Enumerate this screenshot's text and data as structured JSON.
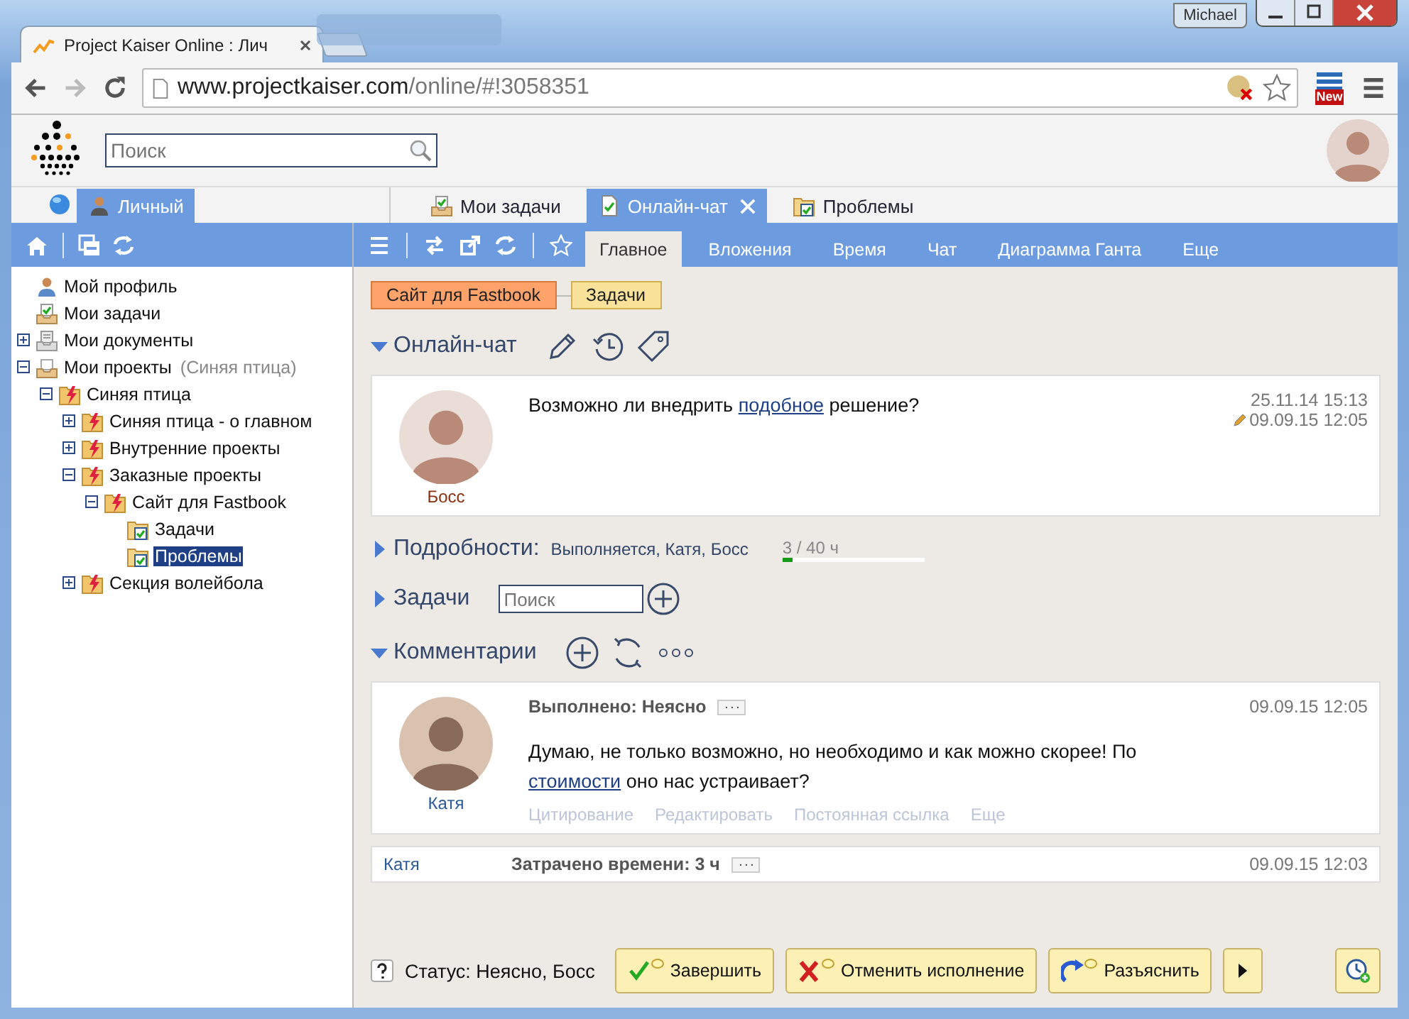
{
  "browser": {
    "user": "Michael",
    "tab_title": "Project Kaiser Online : Лич",
    "address_host": "www.projectkaiser.com",
    "address_path": "/online/#!3058351",
    "extension_badge": "New"
  },
  "app": {
    "search": {
      "placeholder": "Поиск"
    }
  },
  "left_tabs": [
    {
      "label": "Личный",
      "selected": true
    }
  ],
  "doc_tabs": [
    {
      "label": "Мои задачи",
      "kind": "tasks",
      "selected": false,
      "closable": false
    },
    {
      "label": "Онлайн-чат",
      "kind": "doc",
      "selected": true,
      "closable": true
    },
    {
      "label": "Проблемы",
      "kind": "list",
      "selected": false,
      "closable": false
    }
  ],
  "tree": [
    {
      "label": "Мой профиль",
      "kind": "profile",
      "selected": false
    },
    {
      "label": "Мои задачи",
      "kind": "tasks",
      "selected": false
    },
    {
      "label": "Мои документы",
      "kind": "docs",
      "selected": false,
      "expanded": false
    },
    {
      "label": "Мои проекты",
      "note": "(Синяя птица)",
      "kind": "projects",
      "selected": false,
      "expanded": true,
      "children": [
        {
          "label": "Синяя птица",
          "kind": "project",
          "selected": false,
          "expanded": true,
          "children": [
            {
              "label": "Синяя птица - о главном",
              "kind": "project",
              "selected": false,
              "expanded": false
            },
            {
              "label": "Внутренние проекты",
              "kind": "project",
              "selected": false,
              "expanded": false
            },
            {
              "label": "Заказные проекты",
              "kind": "project",
              "selected": false,
              "expanded": true,
              "children": [
                {
                  "label": "Сайт для Fastbook",
                  "kind": "project",
                  "selected": false,
                  "expanded": true,
                  "children": [
                    {
                      "label": "Задачи",
                      "kind": "list",
                      "selected": false
                    },
                    {
                      "label": "Проблемы",
                      "kind": "list",
                      "selected": true
                    }
                  ]
                }
              ]
            },
            {
              "label": "Секция волейбола",
              "kind": "project",
              "selected": false,
              "expanded": false
            }
          ]
        }
      ]
    }
  ],
  "view_tabs": [
    {
      "label": "Главное",
      "selected": true
    },
    {
      "label": "Вложения",
      "selected": false
    },
    {
      "label": "Время",
      "selected": false
    },
    {
      "label": "Чат",
      "selected": false
    },
    {
      "label": "Диаграмма Ганта",
      "selected": false
    },
    {
      "label": "Еще",
      "selected": false
    }
  ],
  "breadcrumbs": [
    {
      "label": "Сайт для Fastbook",
      "kind": "project"
    },
    {
      "label": "Задачи",
      "kind": "list"
    }
  ],
  "chat": {
    "title": "Онлайн-чат",
    "expanded": true,
    "author": "Босс",
    "created": "25.11.14 15:13",
    "edited": "09.09.15 12:05",
    "parts": [
      {
        "text": "Возможно ли внедрить "
      },
      {
        "text": "подобное",
        "link": true
      },
      {
        "text": " решение?"
      }
    ]
  },
  "details": {
    "title": "Подробности:",
    "expanded": false,
    "summary": "Выполняется, Катя, Босс",
    "time": "3 / 40 ч",
    "level": 0.07
  },
  "tasks": {
    "title": "Задачи",
    "expanded": false,
    "search": {
      "placeholder": "Поиск"
    }
  },
  "comments": {
    "title": "Комментарии",
    "expanded": true,
    "items": [
      {
        "kind": "comment",
        "author": "Катя",
        "status": "Выполнено: Неясно",
        "date": "09.09.15 12:05",
        "parts": [
          {
            "text": "Думаю, не только возможно, но необходимо и как можно скорее! По "
          },
          {
            "text": "стоимости",
            "link": true
          },
          {
            "text": " оно нас устраивает?"
          }
        ],
        "actions": [
          "Цитирование",
          "Редактировать",
          "Постоянная ссылка",
          "Еще"
        ]
      },
      {
        "kind": "time",
        "author": "Катя",
        "status": "Затрачено времени: 3 ч",
        "date": "09.09.15 12:03"
      }
    ]
  },
  "status_bar": {
    "status": "Статус: Неясно, Босс",
    "actions": [
      {
        "label": "Завершить",
        "kind": "complete"
      },
      {
        "label": "Отменить исполнение",
        "kind": "cancel"
      },
      {
        "label": "Разъяснить",
        "kind": "clarify"
      }
    ]
  }
}
